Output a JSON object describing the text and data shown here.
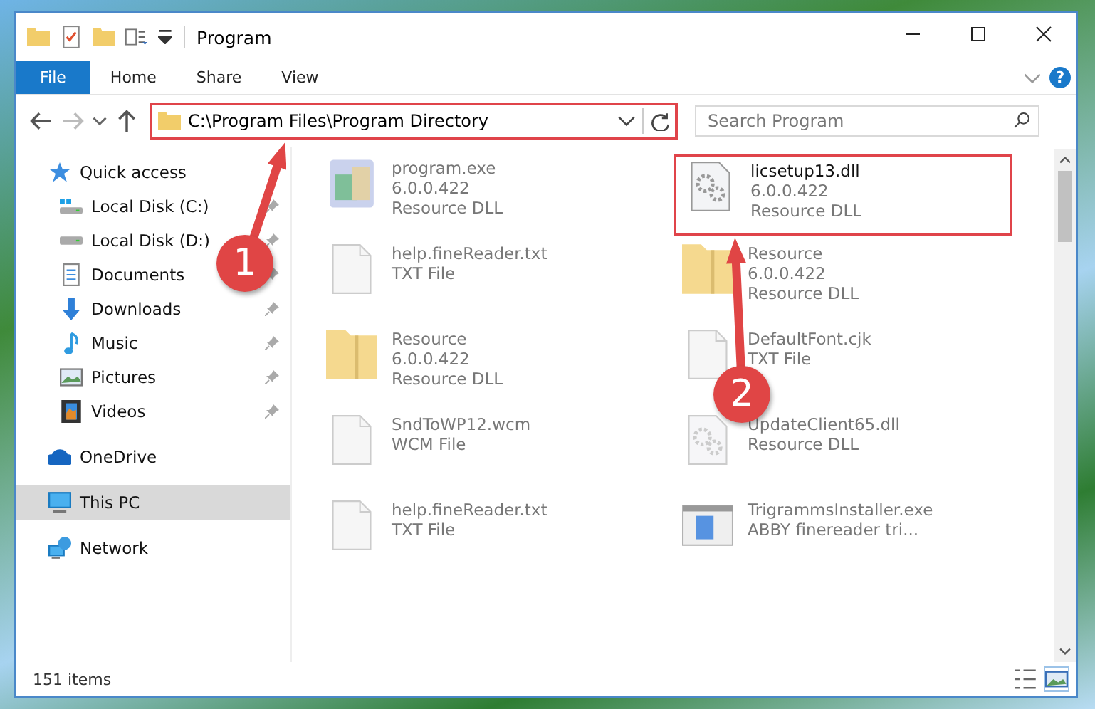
{
  "window": {
    "title": "Program"
  },
  "ribbon": {
    "tabs": [
      {
        "label": "File",
        "selected": true
      },
      {
        "label": "Home",
        "selected": false
      },
      {
        "label": "Share",
        "selected": false
      },
      {
        "label": "View",
        "selected": false
      }
    ],
    "help": "?"
  },
  "address_bar": {
    "path": "C:\\Program Files\\Program Directory",
    "highlighted": true,
    "search": {
      "placeholder": "Search Program"
    }
  },
  "sidebar": {
    "items": [
      {
        "label": "Quick access",
        "pinned": false,
        "selected": false,
        "children": [
          {
            "label": "Local Disk (C:)",
            "pinned": true,
            "selected": false
          },
          {
            "label": "Local Disk (D:)",
            "pinned": true,
            "selected": false
          },
          {
            "label": "Documents",
            "pinned": true,
            "selected": false
          },
          {
            "label": "Downloads",
            "pinned": true,
            "selected": false
          },
          {
            "label": "Music",
            "pinned": true,
            "selected": false
          },
          {
            "label": "Pictures",
            "pinned": true,
            "selected": false
          },
          {
            "label": "Videos",
            "pinned": true,
            "selected": false
          }
        ]
      },
      {
        "label": "OneDrive",
        "pinned": false,
        "selected": false
      },
      {
        "label": "This PC",
        "pinned": false,
        "selected": true
      },
      {
        "label": "Network",
        "pinned": false,
        "selected": false
      }
    ]
  },
  "files": [
    {
      "name": "program.exe",
      "details": [
        "6.0.0.422",
        "Resource DLL"
      ],
      "highlighted": false
    },
    {
      "name": "licsetup13.dll",
      "details": [
        "6.0.0.422",
        "Resource DLL"
      ],
      "highlighted": true
    },
    {
      "name": "help.fineReader.txt",
      "details": [
        "TXT File"
      ],
      "highlighted": false
    },
    {
      "name": "Resource",
      "details": [
        "6.0.0.422",
        "Resource DLL"
      ],
      "highlighted": false
    },
    {
      "name": "Resource",
      "details": [
        "6.0.0.422",
        "Resource DLL"
      ],
      "highlighted": false
    },
    {
      "name": "DefaultFont.cjk",
      "details": [
        "TXT File"
      ],
      "highlighted": false
    },
    {
      "name": "SndToWP12.wcm",
      "details": [
        "WCM File"
      ],
      "highlighted": false
    },
    {
      "name": "UpdateClient65.dll",
      "details": [
        "Resource DLL"
      ],
      "highlighted": false
    },
    {
      "name": "help.fineReader.txt",
      "details": [
        "TXT File"
      ],
      "highlighted": false
    },
    {
      "name": "TrigrammsInstaller.exe",
      "details": [
        "ABBY finereader tri..."
      ],
      "highlighted": false
    }
  ],
  "status_bar": {
    "count": "151 items"
  },
  "callouts": [
    {
      "number": "1"
    },
    {
      "number": "2"
    }
  ]
}
